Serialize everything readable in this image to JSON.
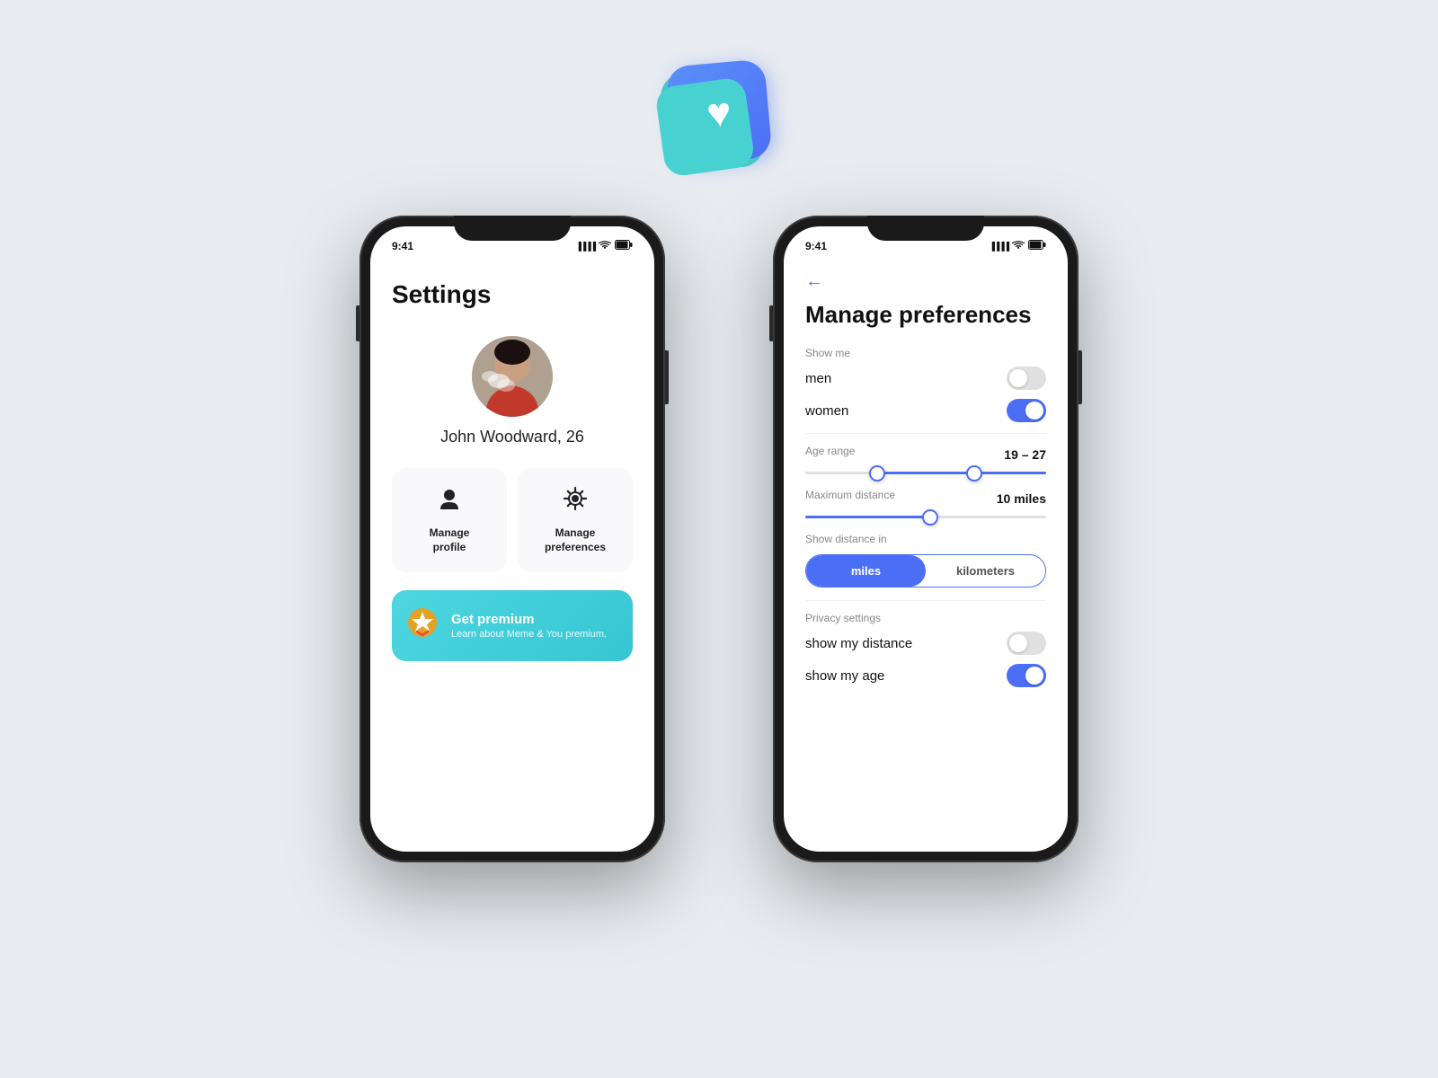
{
  "app_icon": {
    "heart": "♥"
  },
  "phone1": {
    "status_bar": {
      "time": "9:41",
      "signal": "▐▐▐▐",
      "wifi": "WiFi",
      "battery": "🔋"
    },
    "title": "Settings",
    "user_name": "John Woodward, 26",
    "manage_profile_label": "Manage\nprofile",
    "manage_profile_icon": "👤",
    "manage_preferences_label": "Manage\npreferences",
    "manage_preferences_icon": "⚙",
    "premium_badge": "🎗",
    "premium_title": "Get premium",
    "premium_subtitle": "Learn about Meme & You premium."
  },
  "phone2": {
    "status_bar": {
      "time": "9:41",
      "signal": "▐▐▐▐",
      "wifi": "WiFi",
      "battery": "🔋"
    },
    "back_arrow": "←",
    "title": "Manage preferences",
    "show_me_label": "Show me",
    "men_label": "men",
    "men_toggle": "off",
    "women_label": "women",
    "women_toggle": "on",
    "age_range_label": "Age range",
    "age_range_value": "19 – 27",
    "age_range_min_pct": 35,
    "age_range_max_pct": 70,
    "max_distance_label": "Maximum distance",
    "max_distance_value": "10 miles",
    "max_distance_pct": 52,
    "show_distance_label": "Show distance in",
    "unit_miles": "miles",
    "unit_kilometers": "kilometers",
    "active_unit": "miles",
    "privacy_settings_label": "Privacy settings",
    "show_distance_toggle_label": "show my distance",
    "show_distance_toggle": "off",
    "show_age_toggle_label": "show my age",
    "show_age_toggle": "on"
  }
}
